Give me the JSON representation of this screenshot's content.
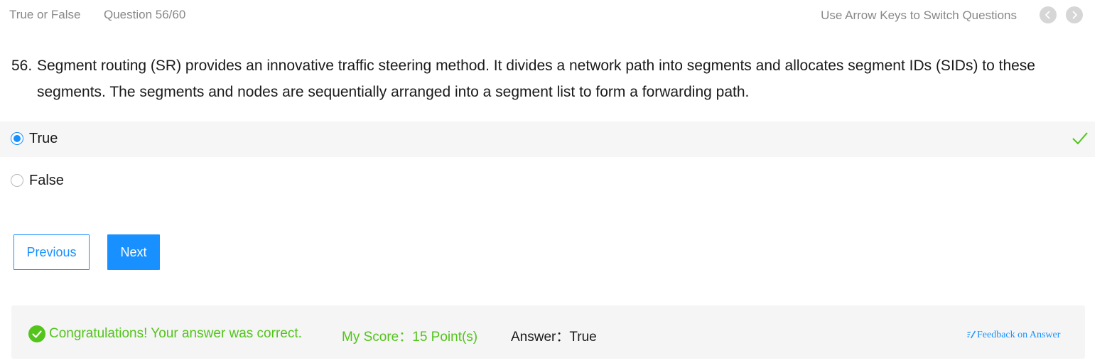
{
  "header": {
    "question_type": "True or False",
    "question_counter": "Question 56/60",
    "nav_hint": "Use Arrow Keys to Switch Questions",
    "prev_icon": "chevron-left-icon",
    "next_icon": "chevron-right-icon"
  },
  "question": {
    "number": "56.",
    "text": "Segment routing (SR) provides an innovative traffic steering method. It divides a network path into segments and allocates segment IDs (SIDs) to these segments. The segments and nodes are sequentially arranged into a segment list to form a forwarding path."
  },
  "options": [
    {
      "label": "True",
      "selected": true,
      "correct": true
    },
    {
      "label": "False",
      "selected": false,
      "correct": false
    }
  ],
  "buttons": {
    "previous": "Previous",
    "next": "Next"
  },
  "result": {
    "message": "Congratulations! Your answer was correct.",
    "score_label": "My Score：",
    "score_value": "15 Point(s)",
    "answer_label": "Answer：",
    "answer_value": "True",
    "feedback_link": "Feedback on Answer"
  },
  "colors": {
    "primary": "#1890ff",
    "success": "#52c41a",
    "muted": "#888888"
  }
}
